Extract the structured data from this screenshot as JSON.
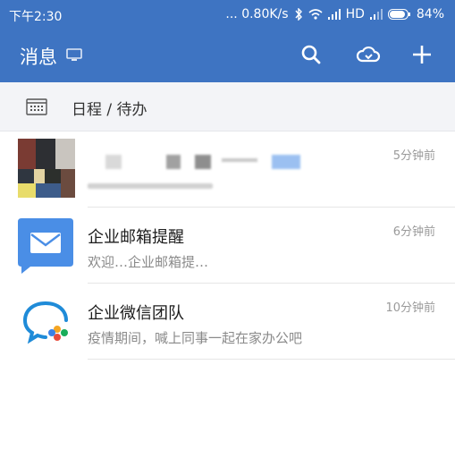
{
  "status_bar": {
    "time": "下午2:30",
    "network_speed": "... 0.80K/s",
    "network_type": "HD",
    "battery": "84%"
  },
  "header": {
    "title": "消息",
    "bg_color": "#3e74c2"
  },
  "schedule": {
    "label": "日程 / 待办"
  },
  "conversations": [
    {
      "title": "",
      "preview": "",
      "time": "5分钟前",
      "avatar": "group-photo"
    },
    {
      "title": "企业邮箱提醒",
      "preview": "欢迎…企业邮箱提…",
      "time": "6分钟前",
      "avatar": "mail-icon",
      "avatar_color": "#4a8ee6"
    },
    {
      "title": "企业微信团队",
      "preview": "疫情期间，喊上同事一起在家办公吧",
      "time": "10分钟前",
      "avatar": "wecom-logo-icon"
    }
  ]
}
